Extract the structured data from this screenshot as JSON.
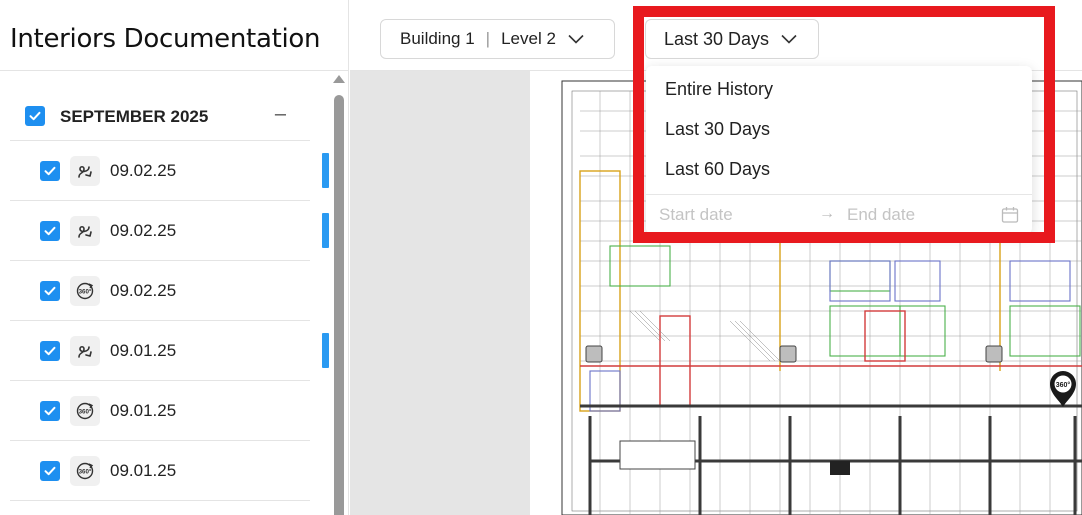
{
  "app": {
    "title": "Interiors Documentation"
  },
  "topbar": {
    "building": "Building 1",
    "separator": "|",
    "level": "Level 2",
    "date_filter": "Last 30 Days"
  },
  "sidebar": {
    "group": {
      "label": "SEPTEMBER 2025",
      "collapse_symbol": "–",
      "checked": true
    },
    "items": [
      {
        "date": "09.02.25",
        "type": "path-icon",
        "checked": true,
        "marked": true
      },
      {
        "date": "09.02.25",
        "type": "path-icon",
        "checked": true,
        "marked": true
      },
      {
        "date": "09.02.25",
        "type": "360-icon",
        "checked": true,
        "marked": false
      },
      {
        "date": "09.01.25",
        "type": "path-icon",
        "checked": true,
        "marked": true
      },
      {
        "date": "09.01.25",
        "type": "360-icon",
        "checked": true,
        "marked": false
      },
      {
        "date": "09.01.25",
        "type": "360-icon",
        "checked": true,
        "marked": false
      }
    ]
  },
  "dropdown": {
    "options": [
      "Entire History",
      "Last 30 Days",
      "Last 60 Days"
    ],
    "start_placeholder": "Start date",
    "end_placeholder": "End date",
    "range_arrow": "→"
  },
  "colors": {
    "accent": "#1e8ff0",
    "marker": "#2a9af2",
    "highlight": "#e8191e"
  }
}
